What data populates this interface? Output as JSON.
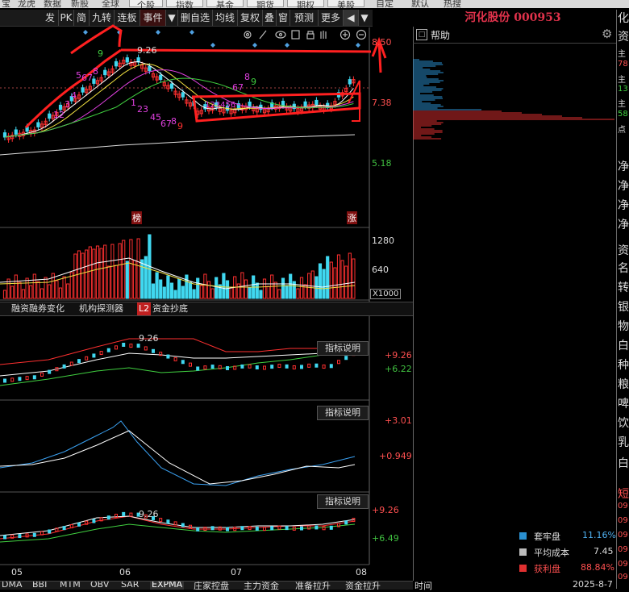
{
  "top_menu": [
    "宝",
    "龙虎",
    "数据",
    "新股",
    "全球",
    "个股",
    "指数",
    "基金",
    "期货",
    "期权",
    "美股",
    "自定",
    "默认",
    "热搜"
  ],
  "toolbar": [
    "发",
    "PK",
    "简",
    "九转",
    "连板",
    "事件",
    "▼",
    "删自选",
    "均线",
    "复权",
    "叠",
    "窗",
    "预测",
    "更多",
    "◀",
    "▼"
  ],
  "stock_title": "河化股份 000953",
  "help_label": "帮助",
  "price_axis": {
    "p1": "8.50",
    "p2": "7.38",
    "p3": "5.18",
    "peak": "9.26"
  },
  "td_labels": {
    "up1": "12",
    "up2": "3",
    "up3": "4",
    "up4": "5",
    "up5": "6",
    "up6": "7",
    "up7": "8",
    "up8": "9",
    "down1": "1",
    "down2": "23",
    "down3": "45",
    "down4": "67",
    "down5": "8",
    "down6": "9",
    "flat": "123456",
    "r1": "67",
    "r2": "8",
    "r3": "9"
  },
  "badges": {
    "bang": "榜",
    "zhang": "涨"
  },
  "volume_axis": {
    "v1": "1280",
    "v2": "640",
    "unit": "X1000"
  },
  "tabs_row": [
    "融资融券变化",
    "机构探测器",
    "L2",
    "资金抄底"
  ],
  "indicator_btn": "指标说明",
  "panel1_axis": {
    "a": "+9.26",
    "b": "+6.22",
    "peak": "9.26"
  },
  "panel2_axis": {
    "a": "+3.01",
    "b": "+0.949"
  },
  "panel3_axis": {
    "a": "+9.26",
    "b": "+6.49",
    "peak": "9.26"
  },
  "months": [
    "05",
    "06",
    "07",
    "08"
  ],
  "bottom_tabs": [
    "DMA",
    "BBI",
    "MTM",
    "OBV",
    "SAR",
    "EXPMA",
    "庄家控盘",
    "主力资金",
    "准备拉升",
    "资金拉升"
  ],
  "bottom_time": "时间",
  "bottom_date": "2025-8-7",
  "legend": [
    {
      "label": "套牢盘",
      "value": "11.16%",
      "color": "#2a8fcf"
    },
    {
      "label": "平均成本",
      "value": "7.45",
      "color": "#bbbbbb"
    },
    {
      "label": "获利盘",
      "value": "88.84%",
      "color": "#e03030"
    }
  ],
  "far_right": [
    "化",
    "资",
    "主",
    "78",
    "主",
    "13",
    "主",
    "58",
    "点",
    "净",
    "净",
    "净",
    "净",
    "资",
    "名",
    "转",
    "银",
    "物",
    "白",
    "种",
    "粮",
    "啤",
    "饮",
    "乳",
    "白",
    "短",
    "09",
    "09",
    "09",
    "09",
    "09",
    "09"
  ],
  "colors": {
    "up": "#ff3030",
    "down": "#40d8f0",
    "annot": "#ff2020"
  }
}
